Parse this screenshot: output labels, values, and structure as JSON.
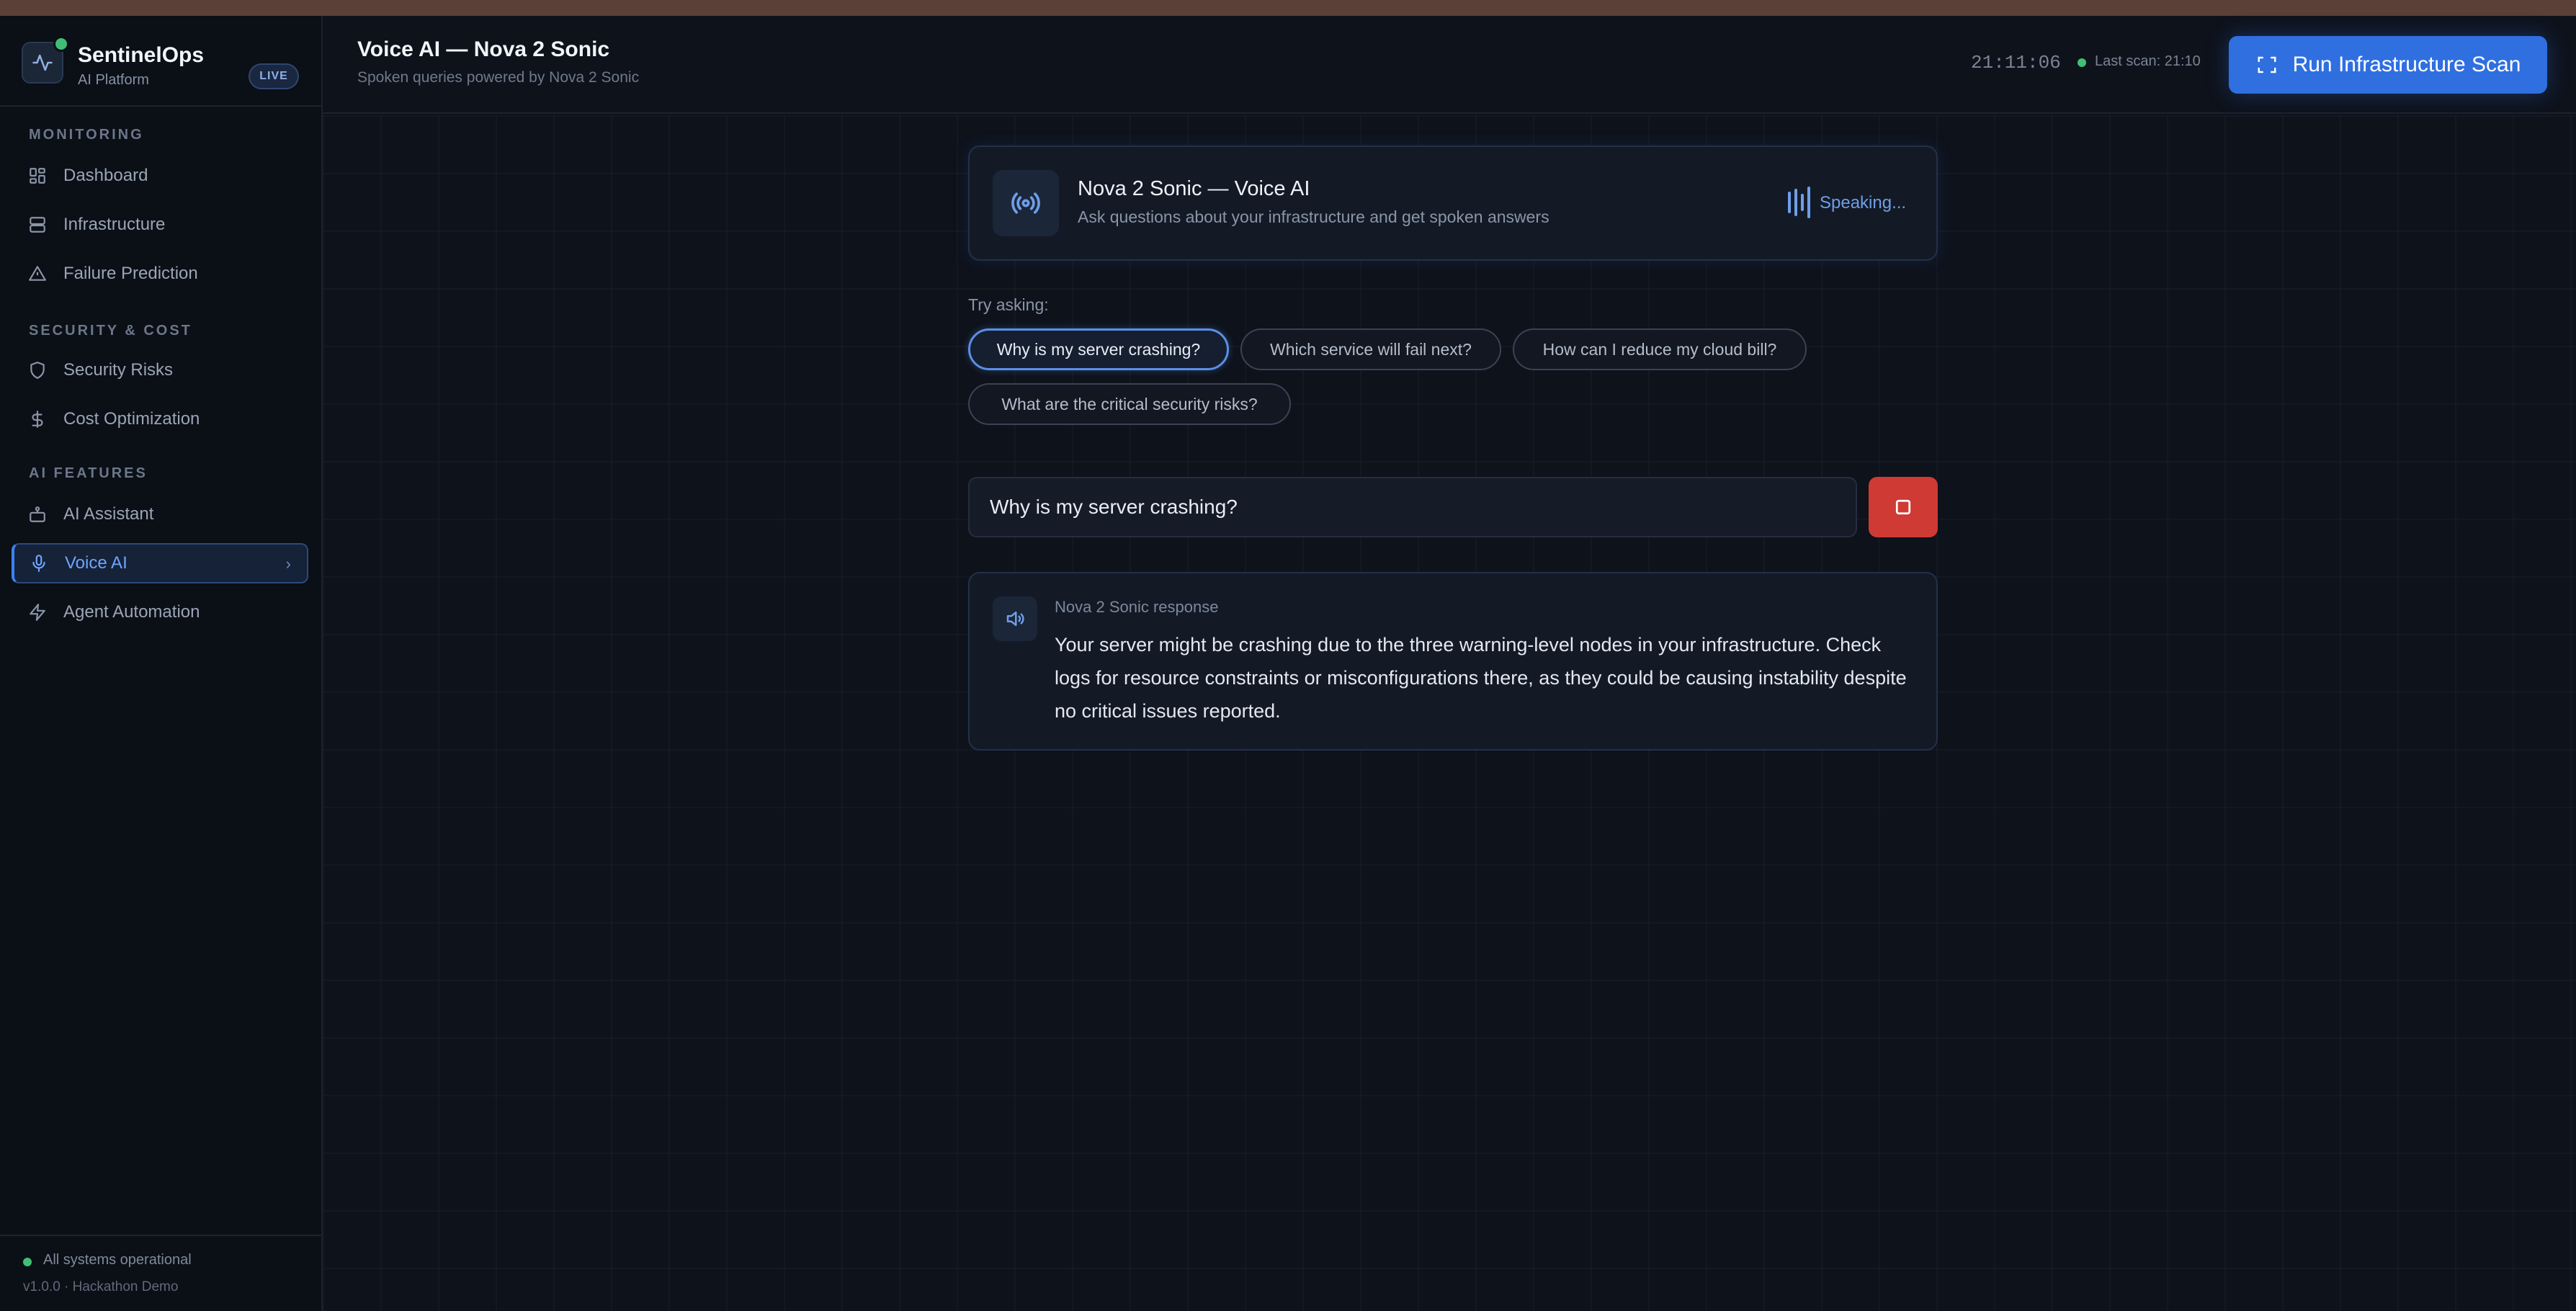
{
  "brand": {
    "name": "SentinelOps",
    "subtitle": "AI Platform",
    "badge": "LIVE"
  },
  "sidebar": {
    "sections": [
      {
        "heading": "MONITORING",
        "items": [
          {
            "label": "Dashboard",
            "icon": "grid-icon"
          },
          {
            "label": "Infrastructure",
            "icon": "server-icon"
          },
          {
            "label": "Failure Prediction",
            "icon": "warning-triangle-icon"
          }
        ]
      },
      {
        "heading": "SECURITY & COST",
        "items": [
          {
            "label": "Security Risks",
            "icon": "shield-icon"
          },
          {
            "label": "Cost Optimization",
            "icon": "dollar-icon"
          }
        ]
      },
      {
        "heading": "AI FEATURES",
        "items": [
          {
            "label": "AI Assistant",
            "icon": "robot-icon"
          },
          {
            "label": "Voice AI",
            "icon": "microphone-icon",
            "active": true
          },
          {
            "label": "Agent Automation",
            "icon": "lightning-icon"
          }
        ]
      }
    ],
    "footer": {
      "status": "All systems operational",
      "version": "v1.0.0 · Hackathon Demo"
    }
  },
  "header": {
    "title": "Voice AI — Nova 2 Sonic",
    "subtitle": "Spoken queries powered by Nova 2 Sonic",
    "clock": "21:11:06",
    "last_scan": "Last scan: 21:10",
    "run_button": "Run Infrastructure Scan"
  },
  "voice_card": {
    "title": "Nova 2 Sonic — Voice AI",
    "subtitle": "Ask questions about your infrastructure and get spoken answers",
    "status": "Speaking..."
  },
  "suggestions": {
    "label": "Try asking:",
    "chips": [
      "Why is my server crashing?",
      "Which service will fail next?",
      "How can I reduce my cloud bill?",
      "What are the critical security risks?"
    ],
    "selected_index": 0
  },
  "query": {
    "value": "Why is my server crashing?"
  },
  "response": {
    "label": "Nova 2 Sonic response",
    "text": "Your server might be crashing due to the three warning-level nodes in your infrastructure. Check logs for resource constraints or misconfigurations there, as they could be causing instability despite no critical issues reported."
  },
  "colors": {
    "accent": "#2f6fe0",
    "active_nav": "#6fa4ff",
    "status_ok": "#3fbf76",
    "stop": "#cf3a34"
  }
}
